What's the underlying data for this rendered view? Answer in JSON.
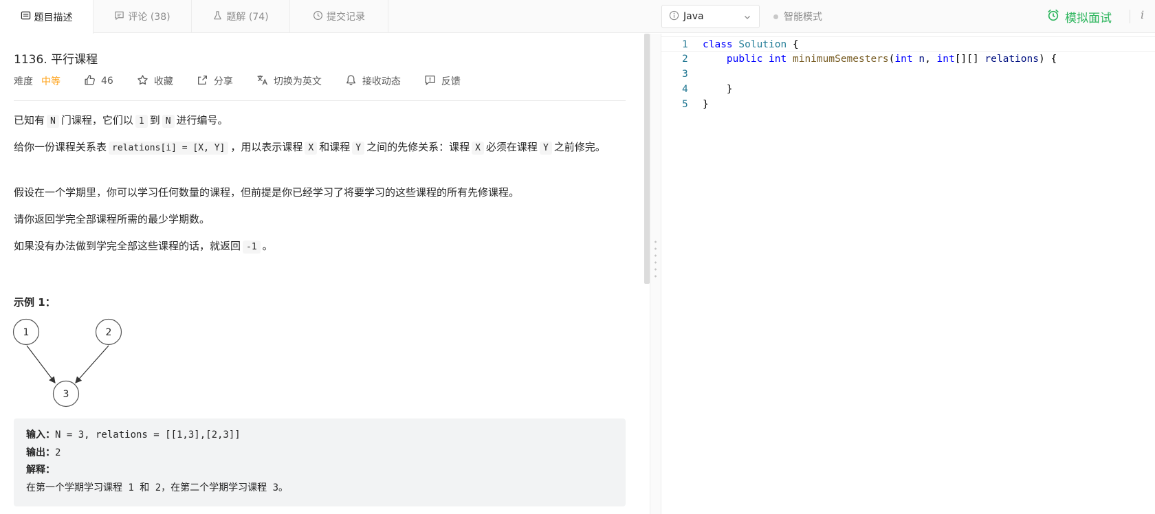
{
  "tabs": [
    {
      "label": "题目描述",
      "icon": "description-icon",
      "active": true
    },
    {
      "label": "评论 (38)",
      "icon": "comment-icon",
      "active": false
    },
    {
      "label": "题解 (74)",
      "icon": "flask-icon",
      "active": false
    },
    {
      "label": "提交记录",
      "icon": "clock-icon",
      "active": false
    }
  ],
  "toolbar": {
    "language": "Java",
    "smart_mode": "智能模式",
    "mock_interview": "模拟面试",
    "info": "i"
  },
  "problem": {
    "title": "1136. 平行课程",
    "difficulty_label": "难度",
    "difficulty": "中等",
    "likes": "46",
    "favorite": "收藏",
    "share": "分享",
    "switch_lang": "切换为英文",
    "subscribe": "接收动态",
    "feedback": "反馈"
  },
  "description": {
    "p1": {
      "a": "已知有",
      "n1": "N",
      "b": "门课程，它们以",
      "one": "1",
      "c": "到",
      "n2": "N",
      "d": "进行编号。"
    },
    "p2": {
      "a": "给你一份课程关系表",
      "rel": "relations[i] = [X, Y]",
      "b": "，用以表示课程",
      "x1": "X",
      "c": "和课程",
      "y1": "Y",
      "d": "之间的先修关系：课程",
      "x2": "X",
      "e": "必须在课程",
      "y2": "Y",
      "f": "之前修完。"
    },
    "p3": "假设在一个学期里，你可以学习任何数量的课程，但前提是你已经学习了将要学习的这些课程的所有先修课程。",
    "p4": "请你返回学完全部课程所需的最少学期数。",
    "p5": {
      "a": "如果没有办法做到学完全部这些课程的话，就返回",
      "neg": "-1",
      "b": "。"
    }
  },
  "example": {
    "title": "示例 1：",
    "graph_nodes": [
      "1",
      "2",
      "3"
    ],
    "input_label": "输入：",
    "input_value": "N = 3, relations = [[1,3],[2,3]]",
    "output_label": "输出：",
    "output_value": "2",
    "explain_label": "解释：",
    "explain_value": "在第一个学期学习课程 1 和 2，在第二个学期学习课程 3。"
  },
  "editor": {
    "line_numbers": [
      "1",
      "2",
      "3",
      "4",
      "5"
    ],
    "code": {
      "class_kw": "class",
      "class_name": "Solution",
      "open_brace": " {",
      "public_kw": "public",
      "int_kw": "int",
      "method": "minimumSemesters",
      "paren_open": "(",
      "p1_type": "int",
      "p1_name": "n",
      "comma": ", ",
      "p2_type": "int",
      "brackets": "[][] ",
      "p2_name": "relations",
      "paren_close": ") {",
      "inner_close": "}",
      "outer_close": "}"
    }
  },
  "colors": {
    "accent_green": "#2db55d",
    "difficulty_orange": "#ffa116"
  }
}
